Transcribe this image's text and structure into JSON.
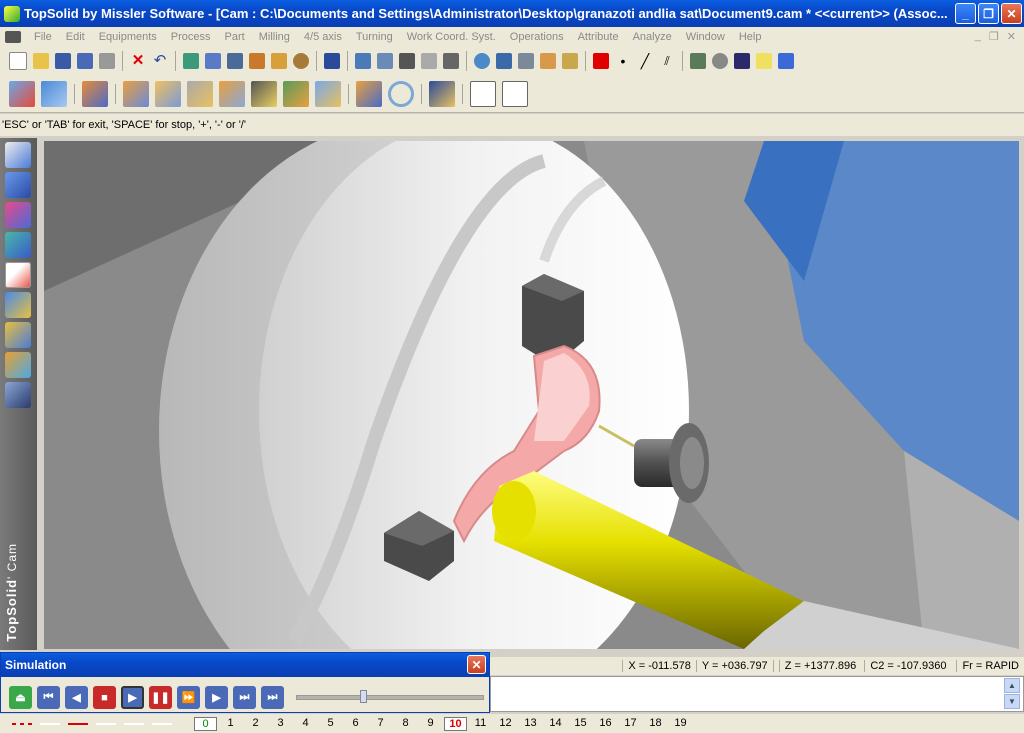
{
  "window": {
    "title": "TopSolid by Missler Software - [Cam : C:\\Documents and Settings\\Administrator\\Desktop\\granazoti andlia sat\\Document9.cam *  <<current>> (Assoc...",
    "minimize": "_",
    "restore": "❐",
    "close": "✕"
  },
  "menu": [
    "File",
    "Edit",
    "Equipments",
    "Process",
    "Part",
    "Milling",
    "4/5 axis",
    "Turning",
    "Work Coord. Syst.",
    "Operations",
    "Attribute",
    "Analyze",
    "Window",
    "Help"
  ],
  "mdi_buttons": [
    "_",
    "❐",
    "✕"
  ],
  "toolbar1": [
    "new-icon",
    "open-icon",
    "save-icon",
    "properties-icon",
    "print-icon",
    "delete-icon",
    "undo-icon",
    "rebuild-icon",
    "cut-icon",
    "tool-icon",
    "measure-icon",
    "modify-icon",
    "settings-icon",
    "select-icon",
    "trim-icon",
    "scissors-icon",
    "line-tool-icon",
    "hand-icon",
    "filter-icon",
    "zoom-icon",
    "fit-icon",
    "view-icon",
    "render-icon",
    "layer-icon",
    "color-swatch-icon",
    "point-style-icon",
    "line-style-icon",
    "hatch-icon",
    "tree-icon",
    "gear-icon",
    "book-icon",
    "help-icon",
    "info-icon"
  ],
  "toolbar1_color": "#e00000",
  "toolbar2": [
    "machine-icon",
    "workpiece-icon",
    "stock-icon",
    "facing-icon",
    "roughing-icon",
    "finishing-icon",
    "grooving-icon",
    "threading-icon",
    "drilling-icon",
    "pocket-icon",
    "contour-icon",
    "circle-icon",
    "tool-holder-icon",
    "nc-code-icon",
    "nc-report-icon"
  ],
  "prompt": "'ESC' or 'TAB' for exit, 'SPACE' for stop, '+', '-' or '/'",
  "sidebar": {
    "items": [
      "sketch-icon",
      "solid-icon",
      "surface-icon",
      "draft-icon",
      "cam-icon",
      "assembly-icon",
      "sheet-icon",
      "library-icon",
      "motion-icon"
    ],
    "active_index": 4,
    "brand": "TopSolid",
    "brand_sub": "' Cam"
  },
  "status": {
    "x": "X = -011.578",
    "y": "Y = +036.797",
    "z": "Z = +1377.896",
    "c2": "C2 = -107.9360",
    "fr": "Fr = RAPID"
  },
  "simulation": {
    "title": "Simulation",
    "close": "✕",
    "controls": [
      "eject-icon",
      "first-icon",
      "step-back-icon",
      "stop-icon",
      "play-icon",
      "pause-icon",
      "fast-forward-icon",
      "step-forward-icon",
      "next-icon",
      "last-icon"
    ],
    "progress": 0.35
  },
  "layers": [
    "0",
    "1",
    "2",
    "3",
    "4",
    "5",
    "6",
    "7",
    "8",
    "9",
    "10",
    "11",
    "12",
    "13",
    "14",
    "15",
    "16",
    "17",
    "18",
    "19"
  ],
  "current_layer": "10"
}
